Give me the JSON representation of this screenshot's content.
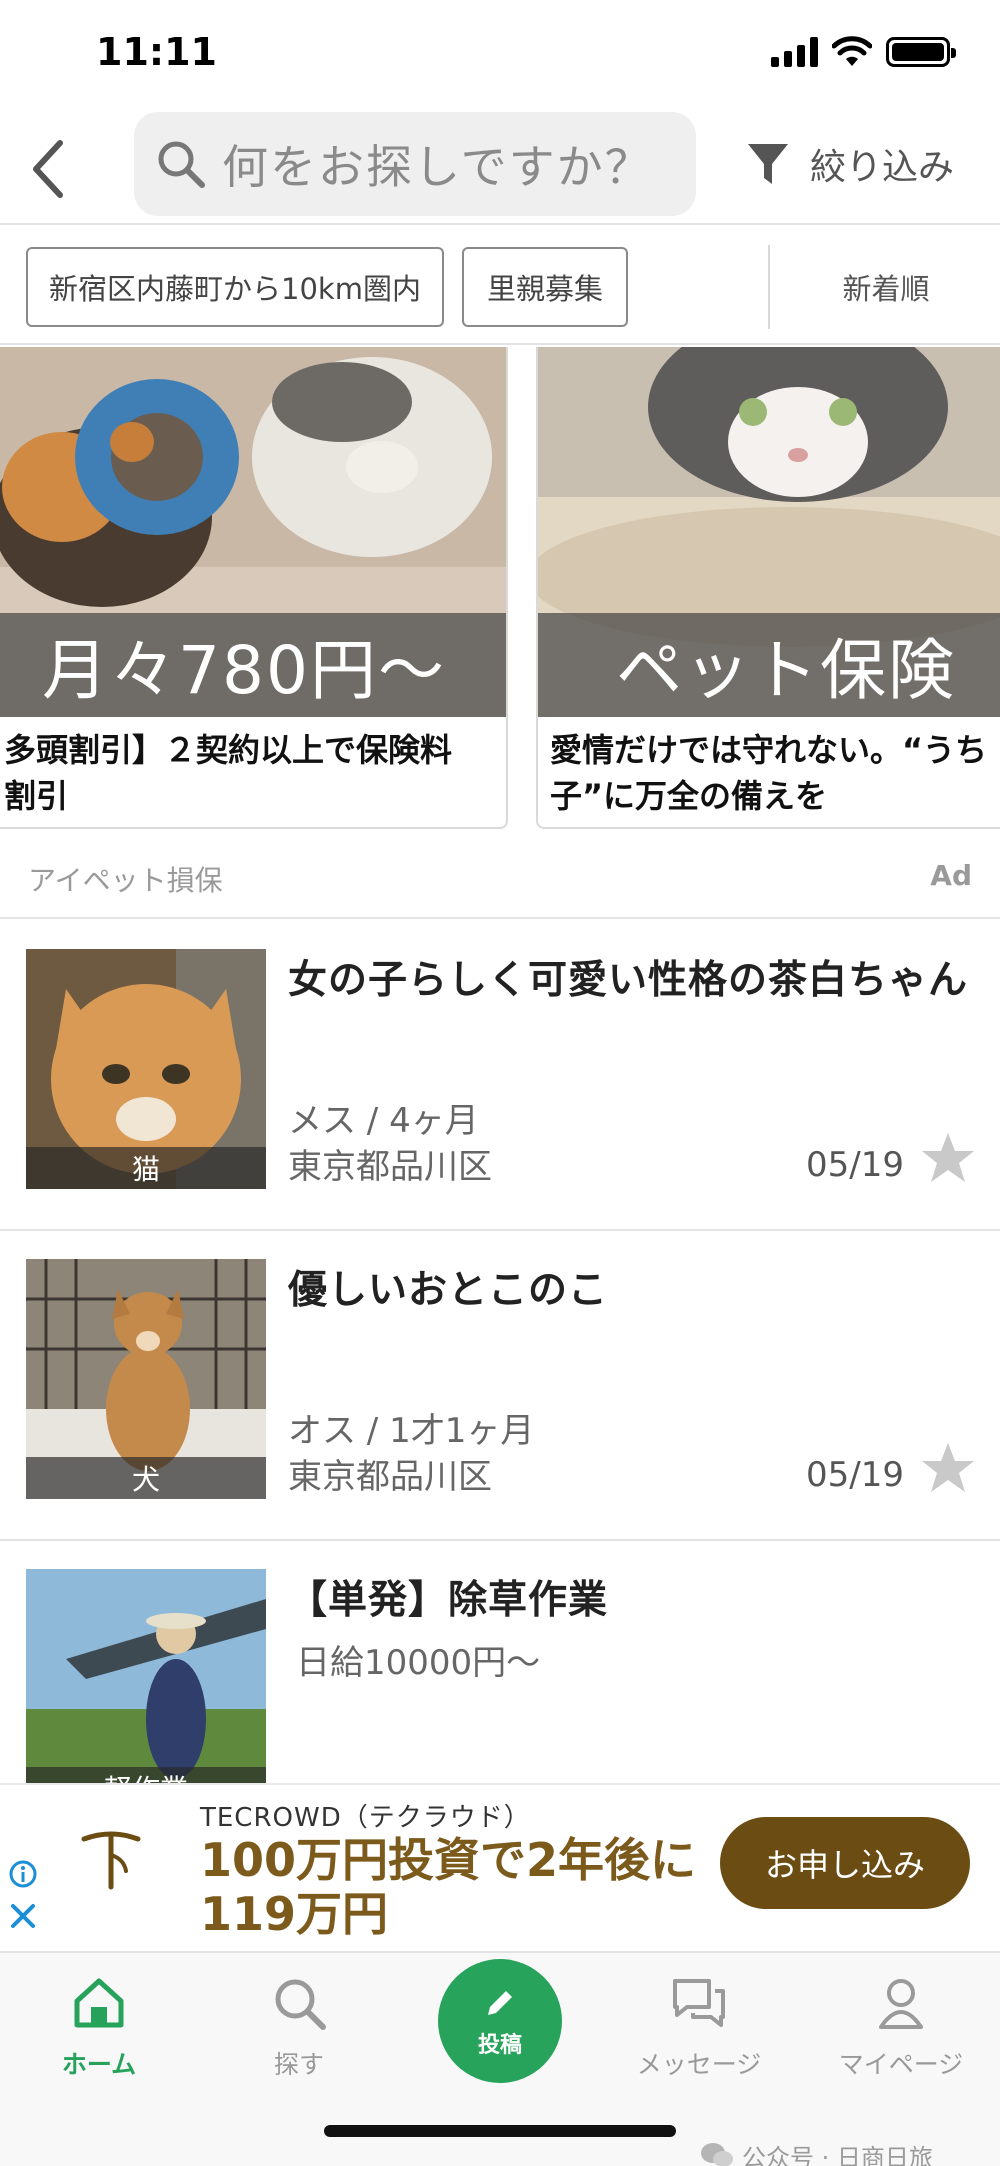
{
  "status_bar": {
    "time": "11:11"
  },
  "header": {
    "search_placeholder": "何をお探しですか？",
    "filter_label": "絞り込み"
  },
  "chips": {
    "location": "新宿区内藤町から10km圏内",
    "category": "里親募集",
    "sort": "新着順"
  },
  "ads": {
    "cards": [
      {
        "overlay": "月々780円～",
        "text": "多頭割引】２契約以上で保険料\n割引"
      },
      {
        "overlay": "ペット保険",
        "text": "愛情だけでは守れない。“うち\n子”に万全の備えを"
      }
    ],
    "sponsor": "アイペット損保",
    "badge": "Ad"
  },
  "listings": [
    {
      "title": "女の子らしく可愛い性格の茶白ちゃん",
      "tag": "猫",
      "details": "メス / 4ヶ月",
      "location": "東京都品川区",
      "date": "05/19",
      "favorited": false
    },
    {
      "title": "優しいおとこのこ",
      "tag": "犬",
      "details": "オス / 1才1ヶ月",
      "location": "東京都品川区",
      "date": "05/19",
      "favorited": false
    },
    {
      "title": "【単発】除草作業",
      "tag": "軽作業",
      "details": "日給10000円～"
    }
  ],
  "banner": {
    "brand": "TECROWD（テクラウド）",
    "headline": "100万円投資で2年後に\n119万円",
    "cta": "お申し込み"
  },
  "tabs": {
    "home": "ホーム",
    "search": "探す",
    "post": "投稿",
    "message": "メッセージ",
    "mypage": "マイページ"
  },
  "colors": {
    "accent_green": "#27a35b",
    "banner_brown": "#6b4c13",
    "banner_text": "#7b5a1c"
  },
  "watermark": "公众号 · 日商日旅"
}
